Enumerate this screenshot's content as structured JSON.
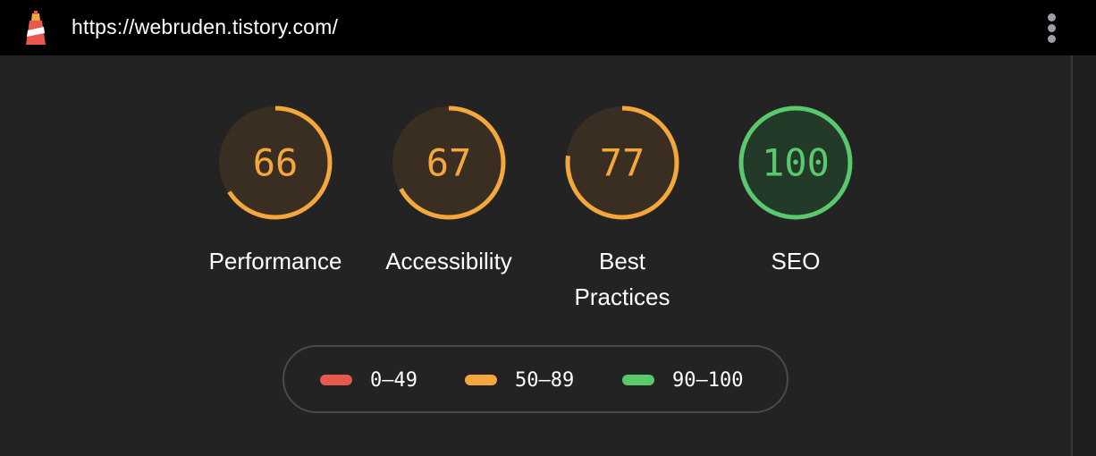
{
  "header": {
    "url": "https://webruden.tistory.com/",
    "logo_icon": "lighthouse-icon",
    "menu_icon": "kebab-menu-icon"
  },
  "gauges": [
    {
      "label": "Performance",
      "score": "66",
      "fraction": 0.66,
      "color": "#f4a73c",
      "track": "#3a2d21"
    },
    {
      "label": "Accessibility",
      "score": "67",
      "fraction": 0.67,
      "color": "#f4a73c",
      "track": "#3a2d21"
    },
    {
      "label": "Best Practices",
      "score": "77",
      "fraction": 0.77,
      "color": "#f4a73c",
      "track": "#3a2d21"
    },
    {
      "label": "SEO",
      "score": "100",
      "fraction": 1.0,
      "color": "#5ac96e",
      "track": "#233a28"
    }
  ],
  "legend": [
    {
      "range": "0–49",
      "color": "#e8594d"
    },
    {
      "range": "50–89",
      "color": "#f4a73c"
    },
    {
      "range": "90–100",
      "color": "#5ac96e"
    }
  ]
}
